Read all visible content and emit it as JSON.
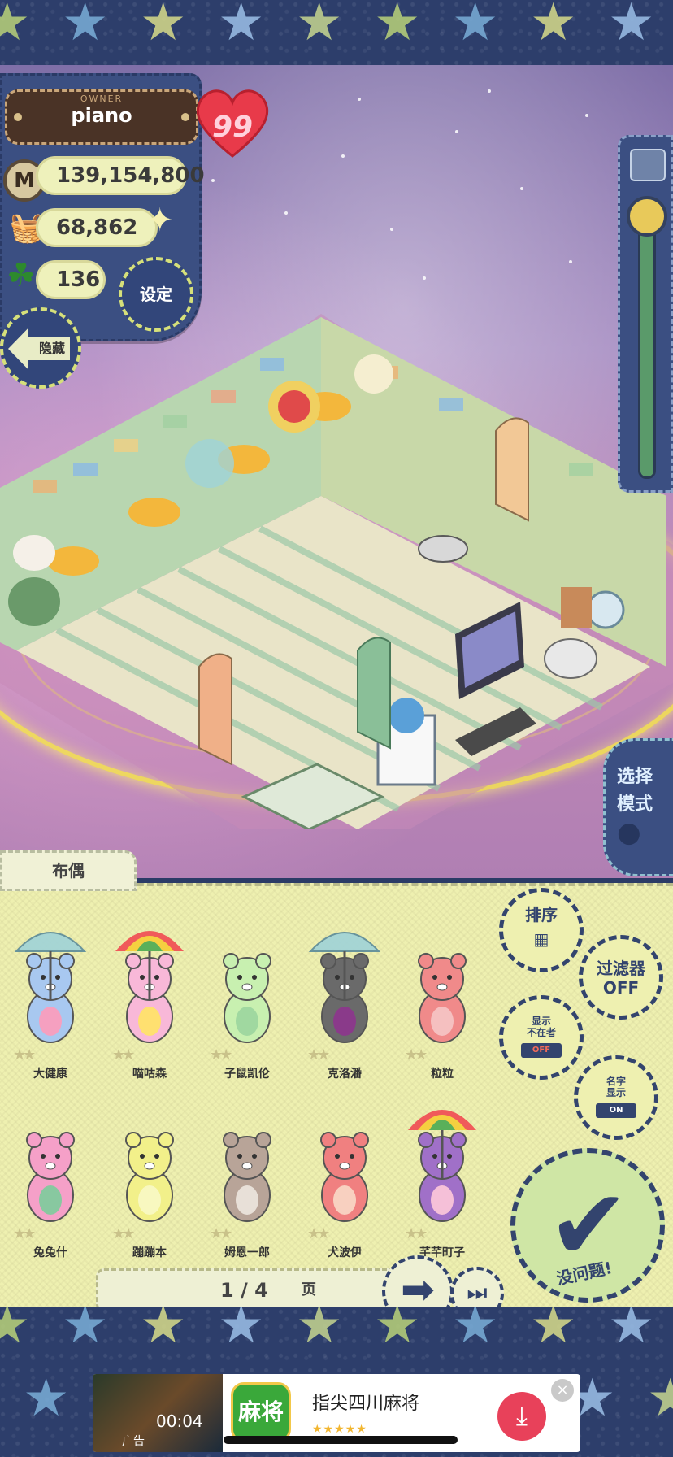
{
  "owner": {
    "caption": "OWNER",
    "name": "piano",
    "hearts": "99"
  },
  "stats": {
    "money_icon": "M",
    "money": "139,154,800",
    "boxes": "68,862",
    "clovers": "136"
  },
  "buttons": {
    "settings": "设定",
    "hide": "隐藏",
    "select_mode_line1": "选择",
    "select_mode_line2": "模式",
    "sort": "排序",
    "filter_line1": "过滤器",
    "filter_line2": "OFF",
    "absent_line1": "显示",
    "absent_line2": "不在者",
    "absent_switch": "OFF",
    "nameview_line1": "名字",
    "nameview_line2": "显示",
    "nameview_switch": "ON",
    "confirm": "没问题!"
  },
  "doll_tab": "布偶",
  "dolls": [
    {
      "name": "大健康",
      "color": "#a8c8f0",
      "accent": "#f5a0c0",
      "umbrella": "#9fd3d8"
    },
    {
      "name": "喵咕森",
      "color": "#f8b8d8",
      "accent": "#ffe070",
      "umbrella": "rainbow"
    },
    {
      "name": "子鼠凯伦",
      "color": "#c8f0b0",
      "accent": "#a0d8a0",
      "umbrella": ""
    },
    {
      "name": "克洛潘",
      "color": "#6a6a6a",
      "accent": "#8a3a8a",
      "umbrella": "#9fd3d8"
    },
    {
      "name": "粒粒",
      "color": "#f08a8a",
      "accent": "#f5c0c0",
      "umbrella": ""
    },
    {
      "name": "兔兔什",
      "color": "#f5a0c8",
      "accent": "#88c8a0",
      "umbrella": ""
    },
    {
      "name": "蹦蹦本",
      "color": "#f2f08a",
      "accent": "#f8f8c0",
      "umbrella": ""
    },
    {
      "name": "姆恩一郎",
      "color": "#b8a498",
      "accent": "#e8e0d8",
      "umbrella": ""
    },
    {
      "name": "犬波伊",
      "color": "#f08080",
      "accent": "#f8d0c0",
      "umbrella": ""
    },
    {
      "name": "芊芊町子",
      "color": "#a070c8",
      "accent": "#f5c0d8",
      "umbrella": "rainbow"
    }
  ],
  "pager": {
    "current": "1 / 4",
    "unit": "页"
  },
  "ad": {
    "timer": "00:04",
    "label": "广告",
    "app_icon_text": "麻将",
    "title": "指尖四川麻将",
    "rating": "★★★★★",
    "close": "×"
  }
}
